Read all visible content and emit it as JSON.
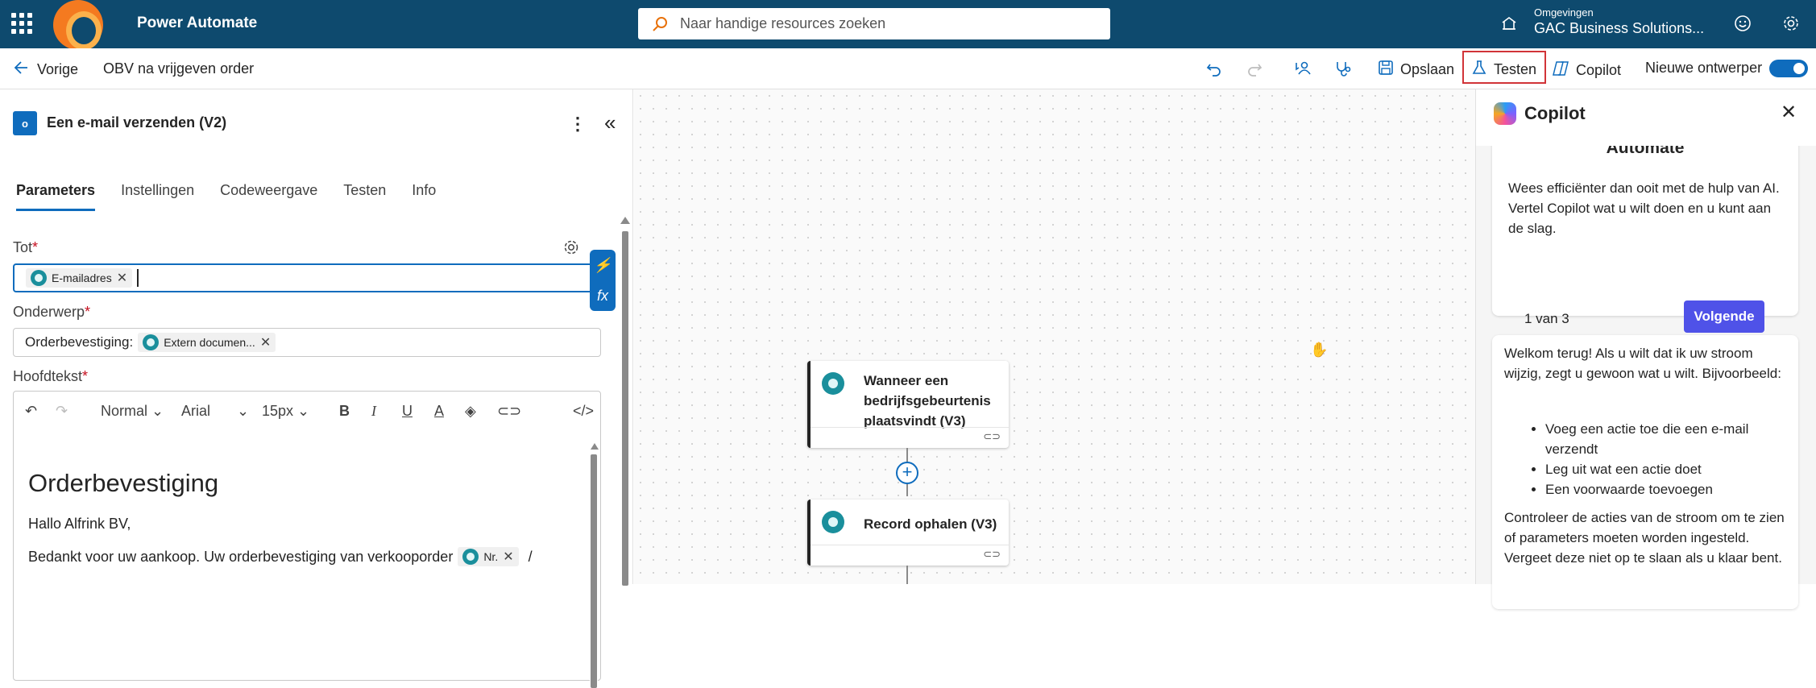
{
  "topbar": {
    "app_title": "Power Automate",
    "search_placeholder": "Naar handige resources zoeken",
    "env_label": "Omgevingen",
    "env_name": "GAC Business Solutions..."
  },
  "cmdbar": {
    "back_label": "Vorige",
    "flow_name": "OBV na vrijgeven order",
    "save_label": "Opslaan",
    "test_label": "Testen",
    "copilot_label": "Copilot",
    "new_designer_label": "Nieuwe ontwerper"
  },
  "panel": {
    "action_icon_text": "o",
    "action_title": "Een e-mail verzenden (V2)",
    "tabs": [
      "Parameters",
      "Instellingen",
      "Codeweergave",
      "Testen",
      "Info"
    ],
    "to_label": "Tot",
    "to_token": "E-mailadres",
    "subject_label": "Onderwerp",
    "subject_prefix": "Orderbevestiging:",
    "subject_token": "Extern documen...",
    "body_label": "Hoofdtekst",
    "editor": {
      "style": "Normal",
      "font": "Arial",
      "size": "15px",
      "heading": "Orderbevestiging",
      "greeting": "Hallo Alfrink BV,",
      "line3": "Bedankt voor uw aankoop. Uw orderbevestiging van verkooporder",
      "line3_token": "Nr.",
      "line3_tail": "/"
    }
  },
  "canvas": {
    "nodes": [
      {
        "title": "Wanneer een bedrijfsgebeurtenis plaatsvindt (V3)"
      },
      {
        "title": "Record ophalen (V3)"
      }
    ]
  },
  "copilot": {
    "title": "Copilot",
    "card_title": "Automate",
    "card_body": "Wees efficiënter dan ooit met de hulp van AI. Vertel Copilot wat u wilt doen en u kunt aan de slag.",
    "card_count": "1 van 3",
    "next_label": "Volgende",
    "welcome": "Welkom terug! Als u wilt dat ik uw stroom wijzig, zegt u gewoon wat u wilt. Bijvoorbeeld:",
    "examples": [
      "Voeg een actie toe die een e-mail verzendt",
      "Leg uit wat een actie doet",
      "Een voorwaarde toevoegen"
    ],
    "review": "Controleer de acties van de stroom om te zien of parameters moeten worden ingesteld. Vergeet deze niet op te slaan als u klaar bent."
  },
  "colors": {
    "topbar": "#0e4a6e",
    "accent": "#0f6cbd",
    "highlight": "#d13438",
    "next_button": "#4f52e8"
  }
}
